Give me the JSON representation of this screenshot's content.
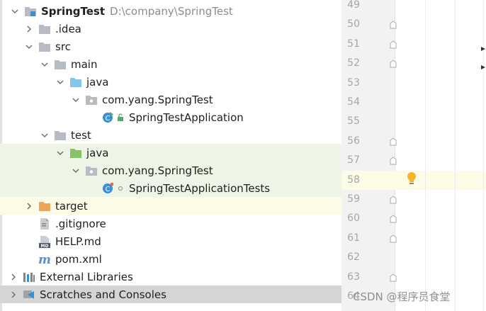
{
  "project_tree": {
    "root": {
      "name": "SpringTest",
      "path": "D:\\company\\SpringTest"
    },
    "items": [
      {
        "label": ".idea"
      },
      {
        "label": "src"
      },
      {
        "label": "main"
      },
      {
        "label": "java"
      },
      {
        "label": "com.yang.SpringTest"
      },
      {
        "label": "SpringTestApplication"
      },
      {
        "label": "test"
      },
      {
        "label": "java"
      },
      {
        "label": "com.yang.SpringTest"
      },
      {
        "label": "SpringTestApplicationTests"
      },
      {
        "label": "target"
      },
      {
        "label": ".gitignore"
      },
      {
        "label": "HELP.md"
      },
      {
        "label": "pom.xml"
      },
      {
        "label": "External Libraries"
      },
      {
        "label": "Scratches and Consoles"
      }
    ]
  },
  "editor": {
    "line_numbers": [
      "49",
      "50",
      "51",
      "52",
      "53",
      "54",
      "55",
      "56",
      "57",
      "58",
      "59",
      "60",
      "61",
      "62",
      "63",
      "64"
    ],
    "current_line": "58"
  },
  "watermark": "CSDN @程序员食堂",
  "colors": {
    "folder": "#b7bcc4",
    "source_folder": "#88c5e4",
    "test_folder": "#86c269",
    "excluded_folder": "#f2a35b",
    "class_icon": "#3c8fd2",
    "test_highlight": "#edf6e6",
    "selection": "#d5d5d5",
    "intention_bulb": "#f5b52a"
  }
}
